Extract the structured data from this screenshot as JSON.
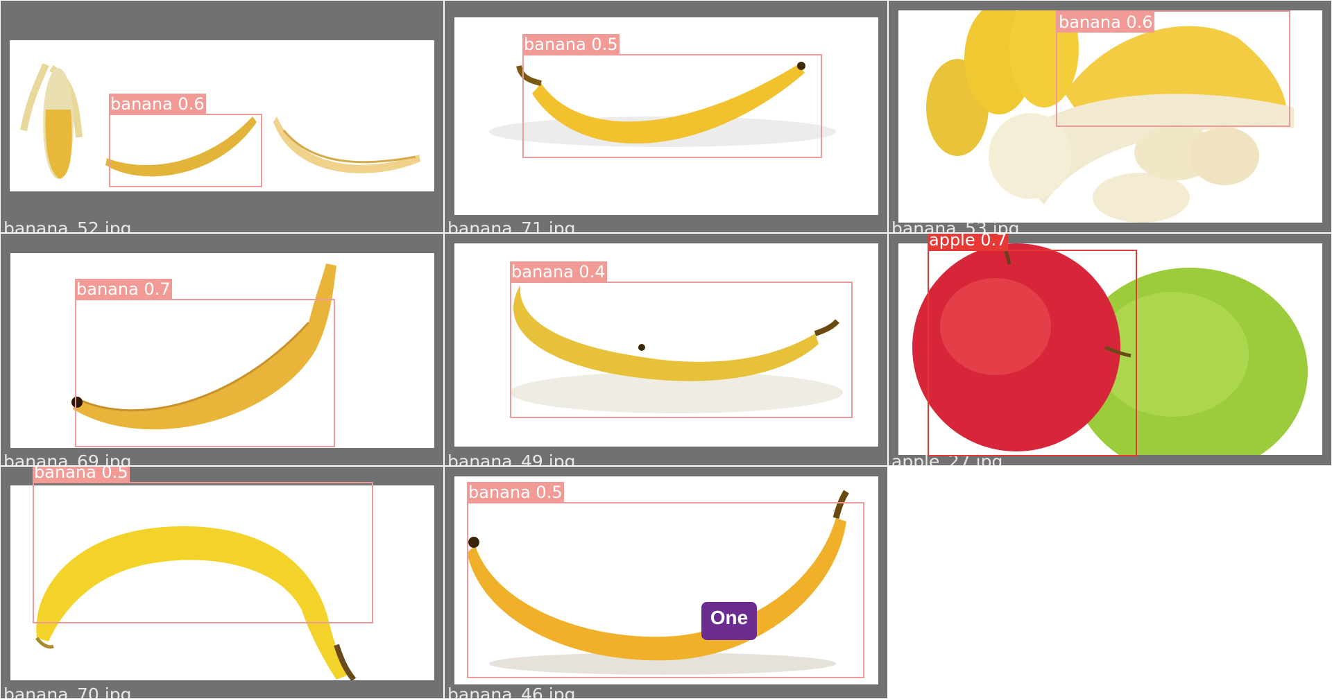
{
  "tiles": [
    {
      "filename": "banana_52.jpg",
      "detections": [
        {
          "label": "banana",
          "score": "0.6",
          "color": "#ef9a9a"
        }
      ]
    },
    {
      "filename": "banana_71.jpg",
      "detections": [
        {
          "label": "banana",
          "score": "0.5",
          "color": "#ef9a9a"
        }
      ]
    },
    {
      "filename": "banana_53.jpg",
      "detections": [
        {
          "label": "banana",
          "score": "0.6",
          "color": "#ef9a9a"
        }
      ]
    },
    {
      "filename": "banana_69.jpg",
      "detections": [
        {
          "label": "banana",
          "score": "0.7",
          "color": "#ef9a9a"
        }
      ]
    },
    {
      "filename": "banana_49.jpg",
      "detections": [
        {
          "label": "banana",
          "score": "0.4",
          "color": "#ef9a9a"
        }
      ]
    },
    {
      "filename": "apple_27.jpg",
      "detections": [
        {
          "label": "apple",
          "score": "0.7",
          "color": "#e53935"
        }
      ]
    },
    {
      "filename": "banana_70.jpg",
      "detections": [
        {
          "label": "banana",
          "score": "0.5",
          "color": "#ef9a9a"
        }
      ]
    },
    {
      "filename": "banana_46.jpg",
      "detections": [
        {
          "label": "banana",
          "score": "0.5",
          "color": "#ef9a9a"
        }
      ]
    }
  ],
  "logo_text": "One",
  "colors": {
    "tile_background": "#717171",
    "banana_box": "#ef9a9a",
    "apple_box": "#e53935",
    "filename_text": "#e7e7e7"
  }
}
